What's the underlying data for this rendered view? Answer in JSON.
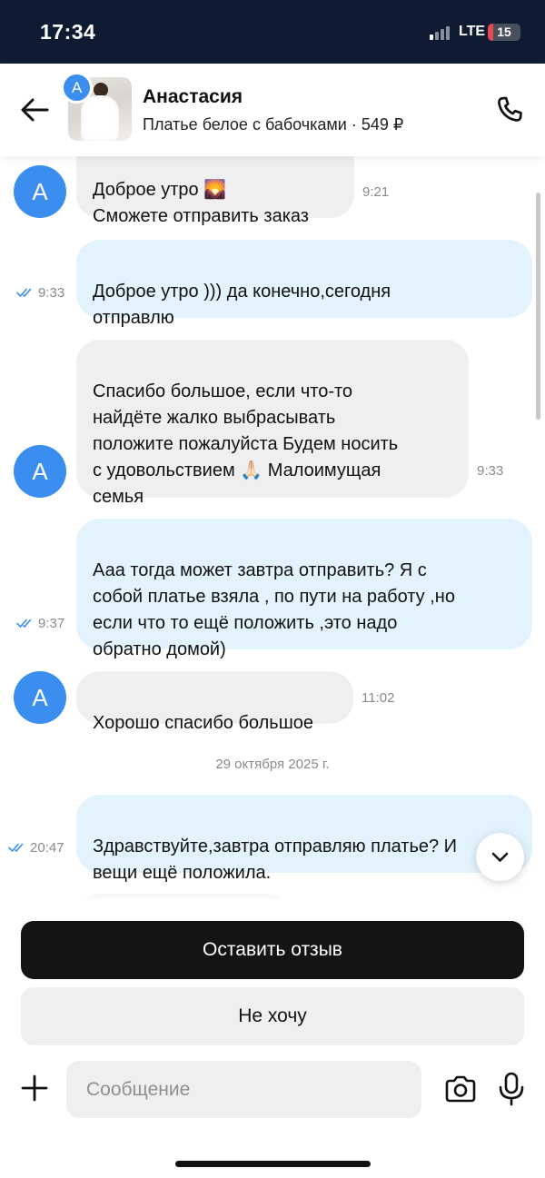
{
  "status_bar": {
    "time": "17:34",
    "network": "LTE",
    "battery": "15"
  },
  "header": {
    "seller_initial": "A",
    "seller_name": "Анастасия",
    "product": "Платье белое с бабочками · 549 ₽"
  },
  "messages": [
    {
      "side": "in",
      "text": "Доброе утро 🌄\nСможете отправить заказ",
      "time": "9:21"
    },
    {
      "side": "out",
      "text": "Доброе утро ))) да конечно,сегодня\nотправлю",
      "time": "9:33",
      "read": true
    },
    {
      "side": "in",
      "text": "Спасибо большое,  если что-то\nнайдёте жалко выбрасывать\nположите пожалуйста Будем носить\nс удовольствием 🙏🏻 Малоимущая\nсемья",
      "time": "9:33"
    },
    {
      "side": "out",
      "text": "Ааа тогда может завтра  отправить? Я с\nсобой платье взяла , по пути на работу ,но\nесли что то ещё положить ,это надо\nобратно домой)",
      "time": "9:37",
      "read": true
    },
    {
      "side": "in",
      "text": "Хорошо спасибо большое",
      "time": "11:02"
    },
    {
      "side": "out",
      "text": "Здравствуйте,завтра отправляю платье? И\nвещи ещё положила.",
      "time": "20:47",
      "read": true
    }
  ],
  "avatar_initial": "A",
  "date_separator": "29 октября 2025 г.",
  "actions": {
    "review": "Оставить отзыв",
    "decline": "Не хочу"
  },
  "composer": {
    "placeholder": "Сообщение"
  },
  "colors": {
    "status_bar": "#0f1a33",
    "avatar": "#3b8ef0",
    "incoming": "#efefef",
    "outgoing": "#e3f3fd",
    "read_ticks": "#3b8ef0"
  },
  "icons": [
    "back-arrow-icon",
    "phone-icon",
    "double-check-icon",
    "chevron-down-icon",
    "plus-icon",
    "camera-icon",
    "microphone-icon"
  ]
}
